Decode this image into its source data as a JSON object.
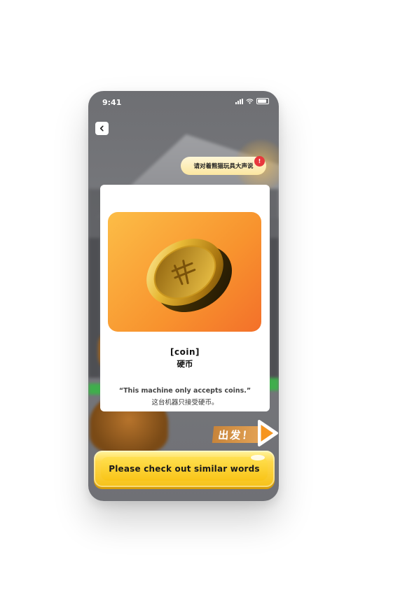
{
  "status_bar": {
    "time": "9:41"
  },
  "hint_bubble": {
    "text": "请对着熊猫玩具大声说",
    "badge": "!"
  },
  "word_card": {
    "word_en": "[coin]",
    "word_zh": "硬币",
    "example_en": "“This machine only accepts coins.”",
    "example_zh": "这台机器只接受硬币。"
  },
  "go_button": {
    "label": "出发！"
  },
  "cta": {
    "label": "Please check out similar words"
  },
  "colors": {
    "card_gradient_start": "#fcbd47",
    "card_gradient_end": "#f3702a",
    "cta_yellow": "#f9c418",
    "badge_red": "#e8383d"
  },
  "icons": {
    "back": "chevron-left-icon",
    "coin": "coin-icon",
    "go": "play-arrow-icon"
  }
}
